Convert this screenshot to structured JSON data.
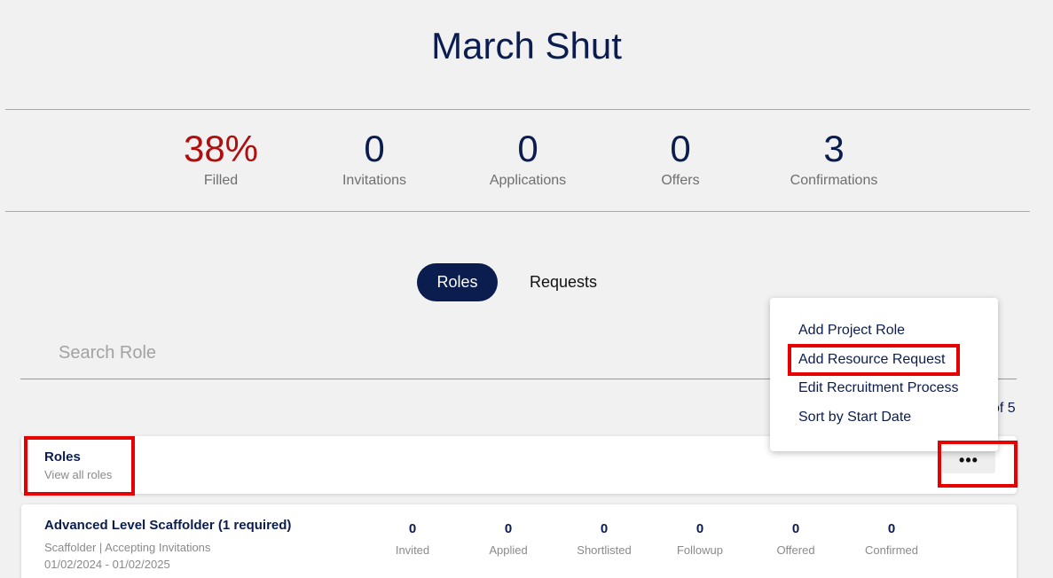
{
  "project": {
    "title": "March Shut"
  },
  "stats": [
    {
      "value": "38%",
      "label": "Filled"
    },
    {
      "value": "0",
      "label": "Invitations"
    },
    {
      "value": "0",
      "label": "Applications"
    },
    {
      "value": "0",
      "label": "Offers"
    },
    {
      "value": "3",
      "label": "Confirmations"
    }
  ],
  "tabs": [
    {
      "label": "Roles",
      "active": true
    },
    {
      "label": "Requests",
      "active": false
    }
  ],
  "search": {
    "placeholder": "Search Role",
    "value": ""
  },
  "pagination": {
    "text": "of 5"
  },
  "roles_header": {
    "title": "Roles",
    "subtitle": "View all roles",
    "more_button": "•••"
  },
  "menu": {
    "items": [
      "Add Project Role",
      "Add Resource Request",
      "Edit Recruitment Process",
      "Sort by Start Date"
    ]
  },
  "role_item": {
    "title": "Advanced Level Scaffolder (1 required)",
    "meta": "Scaffolder | Accepting Invitations",
    "dates": "01/02/2024 - 01/02/2025",
    "stats": [
      {
        "value": "0",
        "label": "Invited"
      },
      {
        "value": "0",
        "label": "Applied"
      },
      {
        "value": "0",
        "label": "Shortlisted"
      },
      {
        "value": "0",
        "label": "Followup"
      },
      {
        "value": "0",
        "label": "Offered"
      },
      {
        "value": "0",
        "label": "Confirmed"
      }
    ]
  },
  "colors": {
    "primary": "#0b1d4f",
    "filled_red": "#b00f0f",
    "highlight": "#e60000"
  }
}
